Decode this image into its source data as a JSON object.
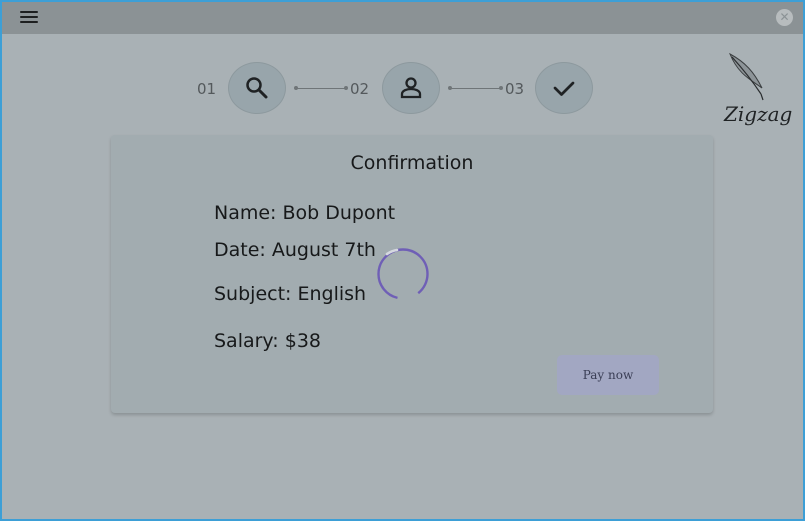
{
  "window": {
    "close_glyph": "✕"
  },
  "stepper": {
    "steps": [
      {
        "number": "01",
        "icon": "search-icon"
      },
      {
        "number": "02",
        "icon": "person-icon"
      },
      {
        "number": "03",
        "icon": "check-icon"
      }
    ]
  },
  "logo": {
    "name": "Zigzag",
    "icon": "feather-quill-icon"
  },
  "confirmation": {
    "title": "Confirmation",
    "name": "Name: Bob Dupont",
    "date": "Date: August 7th",
    "subject": "Subject: English",
    "salary": "Salary: $38",
    "pay_button": "Pay now"
  },
  "loading": {
    "icon": "loading-spinner-icon"
  },
  "colors": {
    "overlay_gray": "#a9b1b5",
    "spinner": "#6f5fb6",
    "button": "#a2a7c2"
  }
}
